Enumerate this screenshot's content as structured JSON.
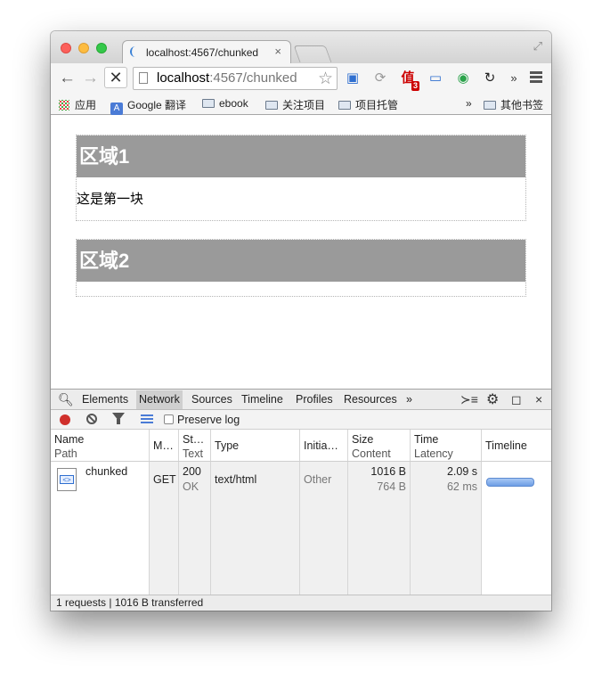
{
  "tab": {
    "title": "localhost:4567/chunked",
    "close": "×"
  },
  "omnibox": {
    "host": "localhost",
    "rest": ":4567/chunked"
  },
  "bookmarks": [
    {
      "label": "应用",
      "icon": "apps-grid-icon"
    },
    {
      "label": "Google 翻译",
      "icon": "google-translate-icon"
    },
    {
      "label": "ebook",
      "icon": "folder-icon"
    },
    {
      "label": "关注项目",
      "icon": "folder-icon"
    },
    {
      "label": "项目托管",
      "icon": "folder-icon"
    },
    {
      "label": "其他书签",
      "icon": "folder-icon"
    }
  ],
  "bookmarks_overflow": "»",
  "toolbar_overflow": "»",
  "extension_badge": "3",
  "page": {
    "regions": [
      {
        "title": "区域1",
        "body": "这是第一块"
      },
      {
        "title": "区域2",
        "body": ""
      }
    ]
  },
  "devtools": {
    "tabs": [
      "Elements",
      "Network",
      "Sources",
      "Timeline",
      "Profiles",
      "Resources"
    ],
    "active_tab": "Network",
    "tabs_overflow": "»",
    "close": "×",
    "preserve_log": "Preserve log",
    "columns": {
      "name": [
        "Name",
        "Path"
      ],
      "method": "M…",
      "status": [
        "St…",
        "Text"
      ],
      "type": "Type",
      "initiator": "Initia…",
      "size": [
        "Size",
        "Content"
      ],
      "time": [
        "Time",
        "Latency"
      ],
      "timeline": "Timeline"
    },
    "rows": [
      {
        "name": "chunked",
        "method": "GET",
        "status_code": "200",
        "status_text": "OK",
        "type": "text/html",
        "initiator": "Other",
        "size": "1016 B",
        "content": "764 B",
        "time": "2.09 s",
        "latency": "62 ms"
      }
    ],
    "status": "1 requests | 1016 B transferred"
  },
  "colors": {
    "region_header": "#9a9a9a",
    "record": "#d0302c",
    "timeline_bar": "#6d9ee6"
  }
}
